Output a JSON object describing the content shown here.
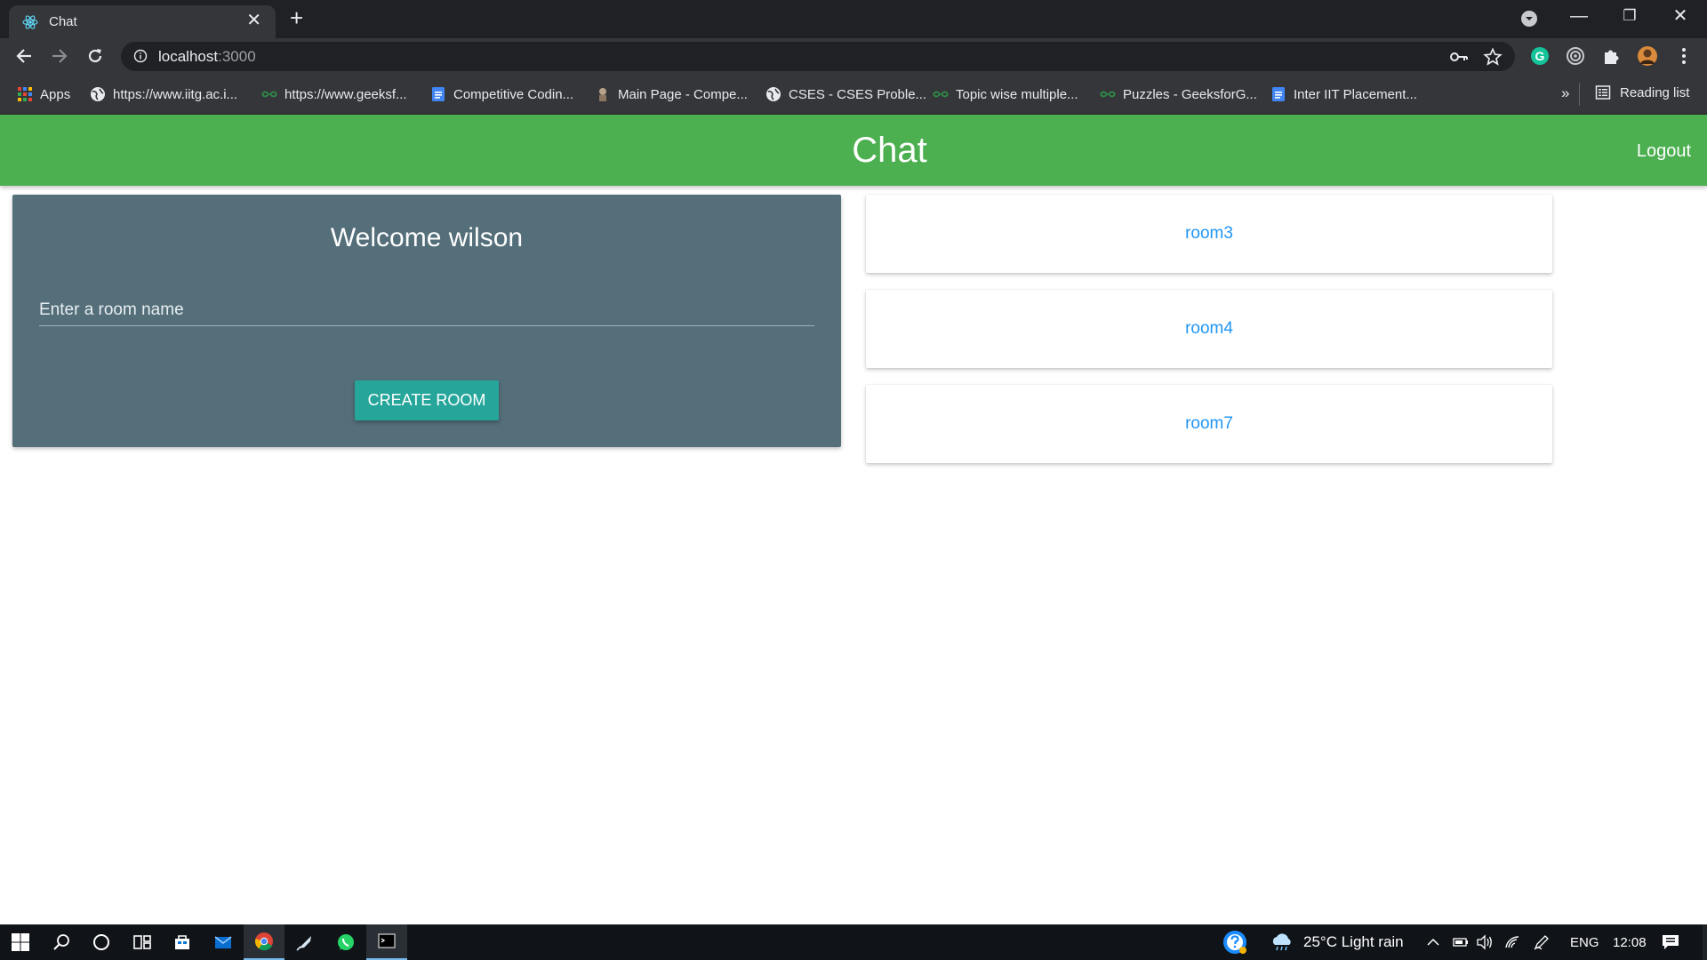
{
  "browser": {
    "tab": {
      "title": "Chat",
      "close": "✕",
      "favicon": "react-icon"
    },
    "new_tab": "+",
    "window_controls": {
      "minimize": "—",
      "maximize": "❐",
      "close": "✕"
    },
    "url": {
      "host": "localhost",
      "port": ":3000"
    },
    "bookmarks": [
      {
        "label": "Apps",
        "icon": "apps-grid-icon"
      },
      {
        "label": "https://www.iitg.ac.i...",
        "icon": "globe-icon"
      },
      {
        "label": "https://www.geeksf...",
        "icon": "geeksforgeeks-icon"
      },
      {
        "label": "Competitive Codin...",
        "icon": "google-docs-icon"
      },
      {
        "label": "Main Page - Compe...",
        "icon": "emblem-icon"
      },
      {
        "label": "CSES - CSES Proble...",
        "icon": "globe-icon"
      },
      {
        "label": "Topic wise multiple...",
        "icon": "geeksforgeeks-icon"
      },
      {
        "label": "Puzzles - GeeksforG...",
        "icon": "geeksforgeeks-icon"
      },
      {
        "label": "Inter IIT Placement...",
        "icon": "google-docs-icon"
      }
    ],
    "bookmarks_more": "»",
    "reading_list": "Reading list",
    "extension_label": "G"
  },
  "app": {
    "header_title": "Chat",
    "logout_label": "Logout",
    "welcome_text": "Welcome wilson",
    "room_input_placeholder": "Enter a room name",
    "create_button_label": "CREATE ROOM",
    "rooms": [
      "room3",
      "room4",
      "room7"
    ]
  },
  "taskbar": {
    "weather": "25°C  Light rain",
    "language": "ENG",
    "time": "12:08"
  },
  "colors": {
    "header_green": "#4caf50",
    "card_slate": "#546e7a",
    "button_teal": "#26a69a",
    "link_blue": "#2196f3"
  }
}
